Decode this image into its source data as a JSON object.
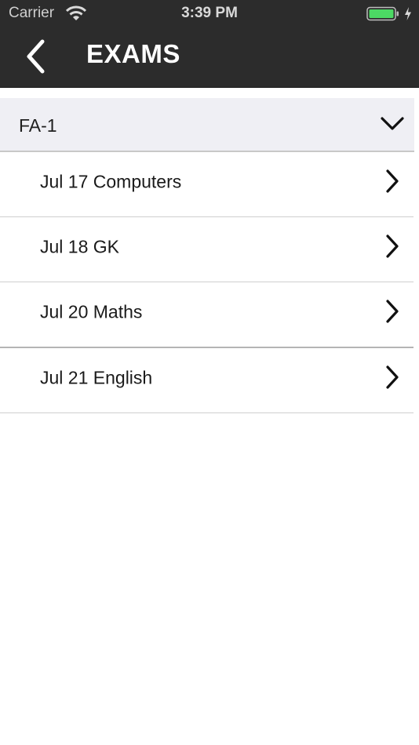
{
  "status_bar": {
    "carrier": "Carrier",
    "time": "3:39 PM",
    "battery_color": "#4cd964"
  },
  "nav": {
    "title": "EXAMS",
    "back_icon": "chevron-left-icon"
  },
  "section": {
    "title": "FA-1",
    "expanded": true,
    "toggle_icon": "chevron-down-icon"
  },
  "exams": [
    {
      "label": "Jul 17 Computers"
    },
    {
      "label": "Jul 18 GK"
    },
    {
      "label": "Jul 20 Maths"
    },
    {
      "label": "Jul 21 English"
    }
  ],
  "colors": {
    "nav_background": "#2c2c2c",
    "section_background": "#efeff4"
  }
}
